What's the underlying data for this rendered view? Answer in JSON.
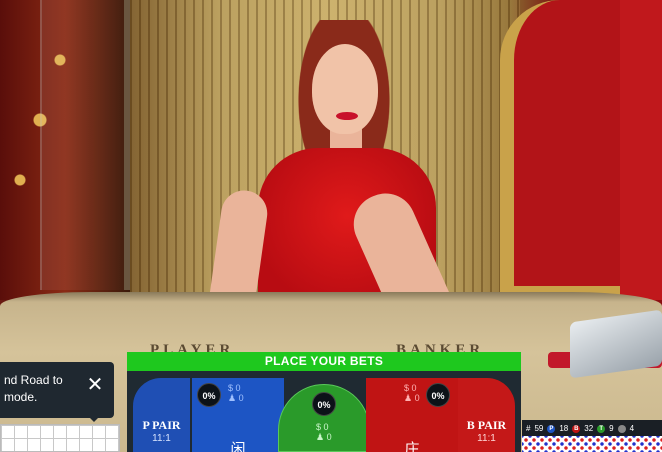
{
  "table_felt": {
    "player_text": "PLAYER",
    "banker_text": "BANKER"
  },
  "tooltip": {
    "line1": "nd Road to",
    "line2": "mode.",
    "close_glyph": "✕"
  },
  "betting": {
    "header": "PLACE YOUR BETS",
    "player_pair": {
      "label": "P PAIR",
      "odds": "11:1"
    },
    "banker_pair": {
      "label": "B PAIR",
      "odds": "11:1"
    },
    "player": {
      "percent": "0%",
      "amount": "$ 0",
      "players": "0",
      "glyph": "闲"
    },
    "tie": {
      "percent": "0%",
      "amount": "$ 0",
      "players": "0"
    },
    "banker": {
      "percent": "0%",
      "amount": "$ 0",
      "players": "0",
      "glyph": "庄"
    }
  },
  "scoreboard": {
    "total_label": "#",
    "total": "59",
    "player_letter": "P",
    "player_count": "18",
    "banker_letter": "B",
    "banker_count": "32",
    "tie_letter": "T",
    "tie_count": "9",
    "extra_count": "4"
  },
  "colors": {
    "header_green": "#1ec81e",
    "player_blue": "#1d55c4",
    "banker_red": "#c01414",
    "tie_green": "#2a9a2a"
  }
}
